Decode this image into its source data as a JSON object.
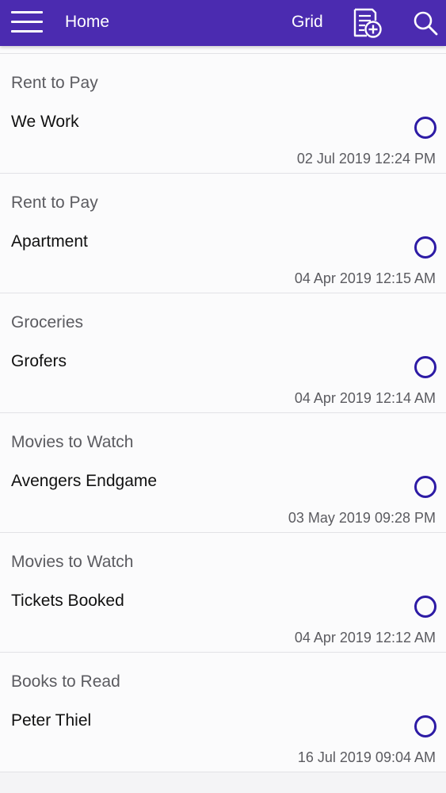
{
  "header": {
    "title": "Home",
    "grid_label": "Grid",
    "menu_icon": "hamburger-menu-icon",
    "add_icon": "add-note-icon",
    "search_icon": "search-icon",
    "background_color": "#4b2bb0"
  },
  "accent_color": "#2d1ba5",
  "cards": [
    {
      "category": "Rent to Pay",
      "title": "We Work",
      "date": "02 Jul 2019 12:24 PM",
      "checked": false
    },
    {
      "category": "Rent to Pay",
      "title": "Apartment",
      "date": "04 Apr 2019 12:15 AM",
      "checked": false
    },
    {
      "category": "Groceries",
      "title": "Grofers",
      "date": "04 Apr 2019 12:14 AM",
      "checked": false
    },
    {
      "category": "Movies to Watch",
      "title": "Avengers Endgame",
      "date": "03 May 2019 09:28 PM",
      "checked": false
    },
    {
      "category": "Movies to Watch",
      "title": "Tickets Booked",
      "date": "04 Apr 2019 12:12 AM",
      "checked": false
    },
    {
      "category": "Books to Read",
      "title": "Peter Thiel",
      "date": "16 Jul 2019 09:04 AM",
      "checked": false
    }
  ]
}
